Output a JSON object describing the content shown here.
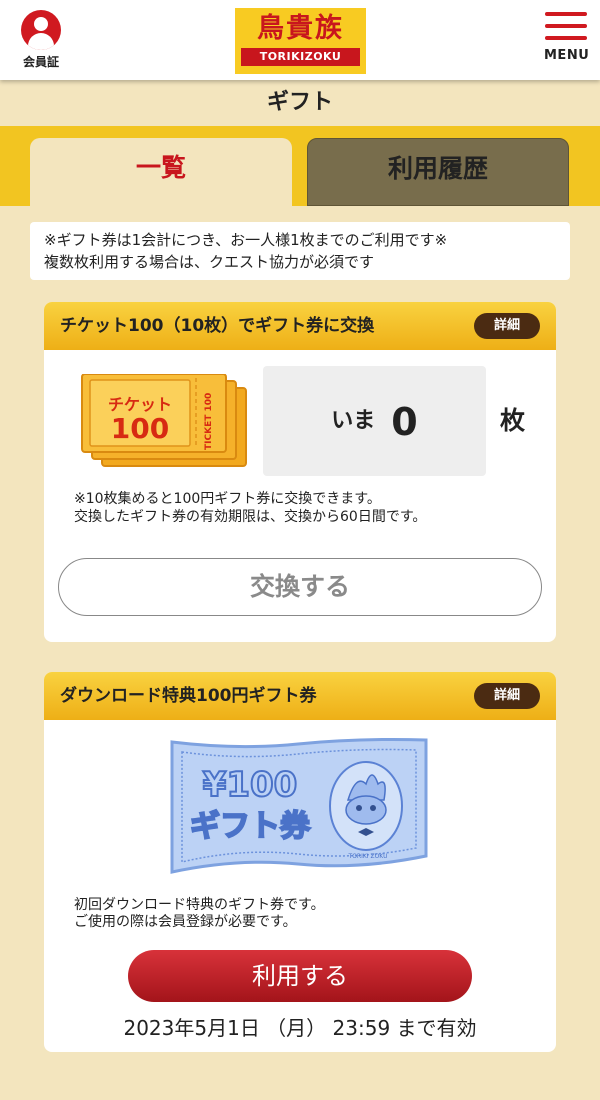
{
  "header": {
    "member_label": "会員証",
    "logo_text": "鳥貴族",
    "logo_roman": "TORIKIZOKU",
    "menu_label": "MENU"
  },
  "page_title": "ギフト",
  "tabs": [
    {
      "label": "一覧",
      "active": true
    },
    {
      "label": "利用履歴",
      "active": false
    }
  ],
  "notice": {
    "line1": "※ギフト券は1会計につき、お一人様1枚までのご利用です※",
    "line2": "複数枚利用する場合は、クエスト協力が必須です"
  },
  "ticket_card": {
    "title": "チケット100（10枚）でギフト券に交換",
    "detail_label": "詳細",
    "ticket_image": {
      "main": "チケット",
      "num": "100",
      "side": "TICKET 100"
    },
    "count_prefix": "いま",
    "count_value": "0",
    "count_unit": "枚",
    "note_line1": "※10枚集めると100円ギフト券に交換できます。",
    "note_line2": "交換したギフト券の有効期限は、交換から60日間です。",
    "exchange_label": "交換する"
  },
  "download_card": {
    "title": "ダウンロード特典100円ギフト券",
    "detail_label": "詳細",
    "gift_image": {
      "amount": "¥100",
      "label": "ギフト券",
      "small": "TORIKI ZOKU"
    },
    "note_line1": "初回ダウンロード特典のギフト券です。",
    "note_line2": "ご使用の際は会員登録が必要です。",
    "use_label": "利用する",
    "expiry": "2023年5月1日 （月） 23:59 まで有効"
  },
  "colors": {
    "brand_red": "#c8161d",
    "brand_yellow": "#f2c521",
    "background": "#f3e5be",
    "detail_brown": "#4b2b12"
  }
}
